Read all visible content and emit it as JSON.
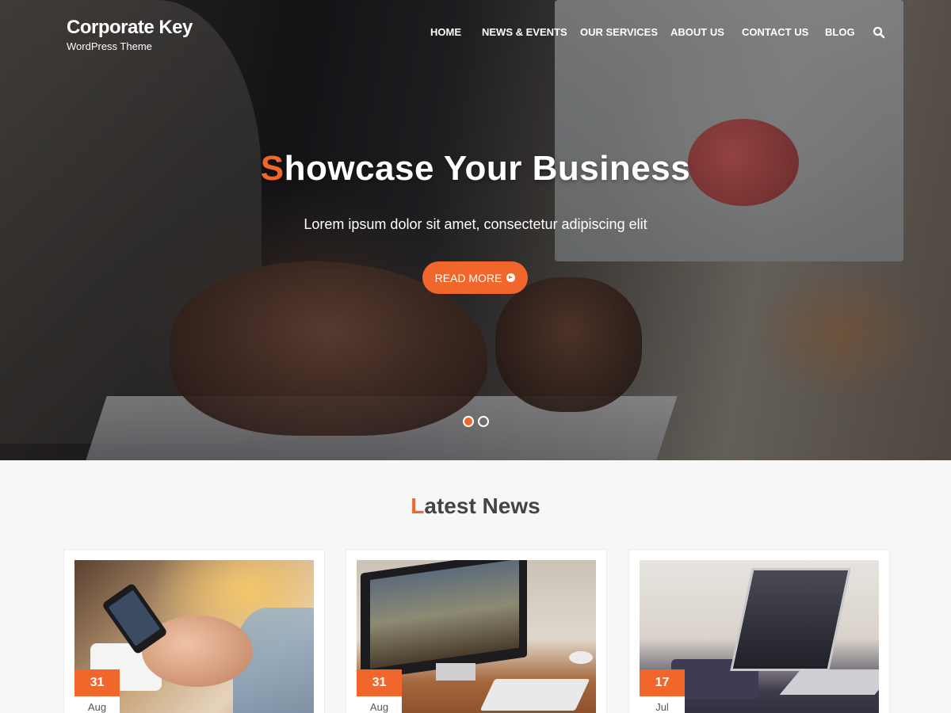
{
  "brand": {
    "title": "Corporate Key",
    "tagline": "WordPress Theme"
  },
  "nav": {
    "items": [
      {
        "label": "HOME"
      },
      {
        "label": "NEWS & EVENTS"
      },
      {
        "label": "OUR SERVICES"
      },
      {
        "label": "ABOUT US"
      },
      {
        "label": "CONTACT US"
      },
      {
        "label": "BLOG"
      }
    ],
    "search_icon": "search-icon"
  },
  "hero": {
    "title_first_letter": "S",
    "title_rest": "howcase Your Business",
    "subtitle": "Lorem ipsum dolor sit amet, consectetur adipiscing elit",
    "button_label": "READ MORE",
    "button_icon": "arrow-circle-right-icon",
    "slides": 2,
    "active_slide": 1
  },
  "news": {
    "title_first_letter": "L",
    "title_rest": "atest News",
    "cards": [
      {
        "day": "31",
        "month": "Aug",
        "image": "phone-in-hands-photo"
      },
      {
        "day": "31",
        "month": "Aug",
        "image": "desktop-monitor-photo"
      },
      {
        "day": "17",
        "month": "Jul",
        "image": "laptop-desk-photo"
      }
    ]
  },
  "colors": {
    "accent": "#f0662b",
    "text_dark": "#444444",
    "background": "#f7f7f7"
  }
}
